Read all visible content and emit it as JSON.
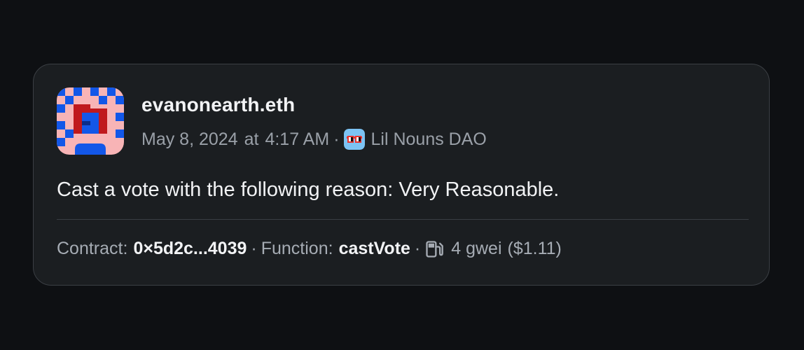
{
  "post": {
    "author": "evanonearth.eth",
    "date": "May 8, 2024",
    "at": "at",
    "time": "4:17 AM",
    "dao_name": "Lil Nouns DAO",
    "dao_icon": "lil-nouns-glasses-icon",
    "text": "Cast a vote with the following reason: Very Reasonable."
  },
  "footer": {
    "contract_label": "Contract:",
    "contract_value": "0×5d2c...4039",
    "function_label": "Function:",
    "function_value": "castVote",
    "gas_icon": "gas-pump-icon",
    "gas_value": "4 gwei",
    "gas_usd": "($1.11)"
  },
  "separator": "·",
  "colors": {
    "background": "#0e1013",
    "card": "#1b1e21",
    "avatar_pink": "#f8b4b6",
    "avatar_blue": "#1357e8",
    "avatar_red": "#c0191d",
    "dao_icon_bg": "#7cc3f4"
  }
}
